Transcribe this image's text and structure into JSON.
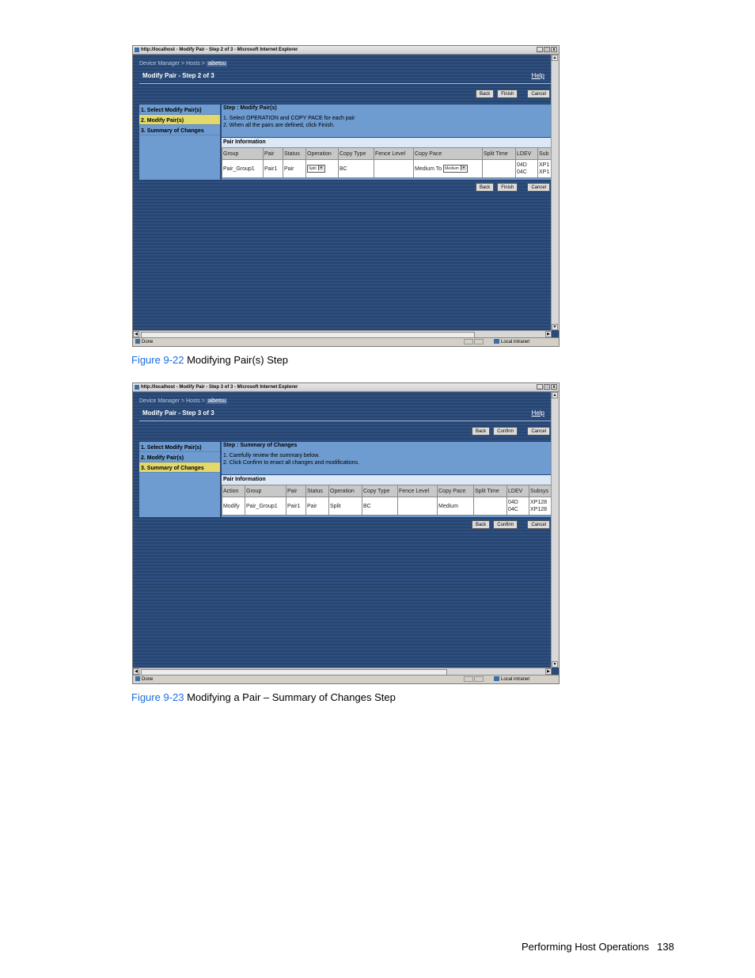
{
  "screenshot1": {
    "window_title": "http://localhost - Modify Pair - Step 2 of 3 - Microsoft Internet Explorer",
    "window_controls": [
      "_",
      "□",
      "x"
    ],
    "breadcrumb": [
      "Device Manager",
      "Hosts",
      "aibetsu"
    ],
    "breadcrumb_sep": " > ",
    "page_title": "Modify Pair - Step 2 of 3",
    "help_label": "Help",
    "buttons": {
      "back": "Back",
      "primary": "Finish",
      "cancel": "Cancel"
    },
    "nav": [
      "1. Select Modify Pair(s)",
      "2. Modify Pair(s)",
      "3. Summary of Changes"
    ],
    "active_nav_index": 1,
    "step_title": "Step : Modify Pair(s)",
    "instructions": [
      "1. Select OPERATION and COPY PACE for each pair",
      "2. When all the pairs are defined, click Finish."
    ],
    "pair_info_label": "Pair Information",
    "columns": [
      "Group",
      "Pair",
      "Status",
      "Operation",
      "Copy Type",
      "Fence Level",
      "Copy Pace",
      "Split Time",
      "LDEV",
      "Sub"
    ],
    "row": {
      "group": "Pair_Group1",
      "pair": "Pair1",
      "status": "Pair",
      "operation": "Split",
      "copy_type": "BC",
      "fence_level": "",
      "copy_pace_text": "Medium To",
      "copy_pace_select": "Medium",
      "split_time": "",
      "ldev": [
        "04D",
        "04C"
      ],
      "sub": [
        "XP1",
        "XP1"
      ]
    },
    "status_text": "Done",
    "zone_text": "Local intranet"
  },
  "caption1": {
    "figure": "Figure 9-22",
    "text": " Modifying Pair(s) Step"
  },
  "screenshot2": {
    "window_title": "http://localhost - Modify Pair - Step 3 of 3 - Microsoft Internet Explorer",
    "window_controls": [
      "_",
      "□",
      "x"
    ],
    "breadcrumb": [
      "Device Manager",
      "Hosts",
      "aibetsu"
    ],
    "breadcrumb_sep": " > ",
    "page_title": "Modify Pair - Step 3 of 3",
    "help_label": "Help",
    "buttons": {
      "back": "Back",
      "primary": "Confirm",
      "cancel": "Cancel"
    },
    "nav": [
      "1. Select Modify Pair(s)",
      "2. Modify Pair(s)",
      "3. Summary of Changes"
    ],
    "active_nav_index": 2,
    "step_title": "Step : Summary of Changes",
    "instructions": [
      "1. Carefully review the summary below.",
      "2. Click Confirm to enact all changes and modifications."
    ],
    "pair_info_label": "Pair Information",
    "columns": [
      "Action",
      "Group",
      "Pair",
      "Status",
      "Operation",
      "Copy Type",
      "Fence Level",
      "Copy Pace",
      "Split Time",
      "LDEV",
      "Subsys"
    ],
    "row": {
      "action": "Modify",
      "group": "Pair_Group1",
      "pair": "Pair1",
      "status": "Pair",
      "operation": "Split",
      "copy_type": "BC",
      "fence_level": "",
      "copy_pace": "Medium",
      "split_time": "",
      "ldev": [
        "04D",
        "04C"
      ],
      "subsys": [
        "XP128",
        "XP128"
      ]
    },
    "status_text": "Done",
    "zone_text": "Local intranet"
  },
  "caption2": {
    "figure": "Figure 9-23",
    "text": " Modifying a Pair – Summary of Changes Step"
  },
  "footer": {
    "section": "Performing Host Operations",
    "page": "138"
  }
}
